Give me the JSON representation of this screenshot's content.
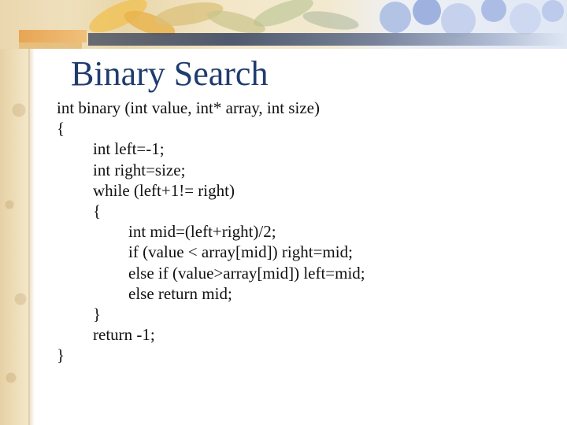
{
  "slide": {
    "title": "Binary Search",
    "code_lines": [
      {
        "text": "int binary (int value, int* array, int size)",
        "indent": 0
      },
      {
        "text": "{",
        "indent": 0
      },
      {
        "text": "int left=-1;",
        "indent": 1
      },
      {
        "text": "int right=size;",
        "indent": 1
      },
      {
        "text": "while (left+1!= right)",
        "indent": 1
      },
      {
        "text": "{",
        "indent": 1
      },
      {
        "text": "int mid=(left+right)/2;",
        "indent": 2
      },
      {
        "text": "if (value < array[mid]) right=mid;",
        "indent": 2
      },
      {
        "text": "else if (value>array[mid]) left=mid;",
        "indent": 2
      },
      {
        "text": "else return mid;",
        "indent": 2
      },
      {
        "text": "}",
        "indent": 1
      },
      {
        "text": "return -1;",
        "indent": 1
      },
      {
        "text": "}",
        "indent": 0
      }
    ]
  },
  "colors": {
    "title": "#1f3c6e",
    "code_text": "#111111",
    "parchment": "#e6d1a6",
    "accent_orange": "#e8a555",
    "accent_blue": "#3e4a63"
  },
  "decorations": {
    "top_left_art": "leaf-artwork",
    "top_right_art": "flower-artwork"
  }
}
